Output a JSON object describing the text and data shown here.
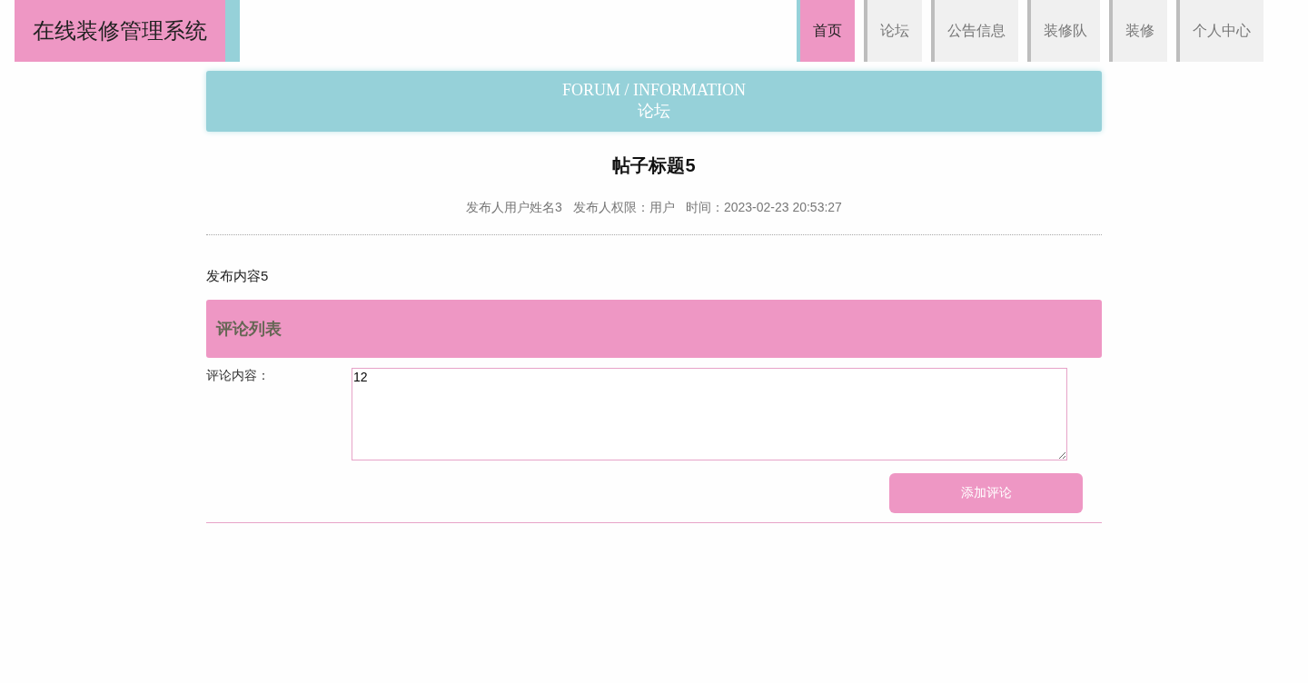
{
  "header": {
    "site_title": "在线装修管理系统"
  },
  "nav": [
    {
      "label": "首页",
      "selected": true
    },
    {
      "label": "论坛",
      "selected": false
    },
    {
      "label": "公告信息",
      "selected": false
    },
    {
      "label": "装修队",
      "selected": false
    },
    {
      "label": "装修",
      "selected": false
    },
    {
      "label": "个人中心",
      "selected": false
    }
  ],
  "banner": {
    "title_en": "FORUM / INFORMATION",
    "title_cn": "论坛"
  },
  "post": {
    "title": "帖子标题5",
    "meta": [
      "发布人用户姓名3",
      "发布人权限：用户",
      "时间：2023-02-23 20:53:27"
    ],
    "content": "发布内容5"
  },
  "comments": {
    "heading": "评论列表",
    "field_label": "评论内容：",
    "value": "12",
    "submit": "添加评论"
  }
}
